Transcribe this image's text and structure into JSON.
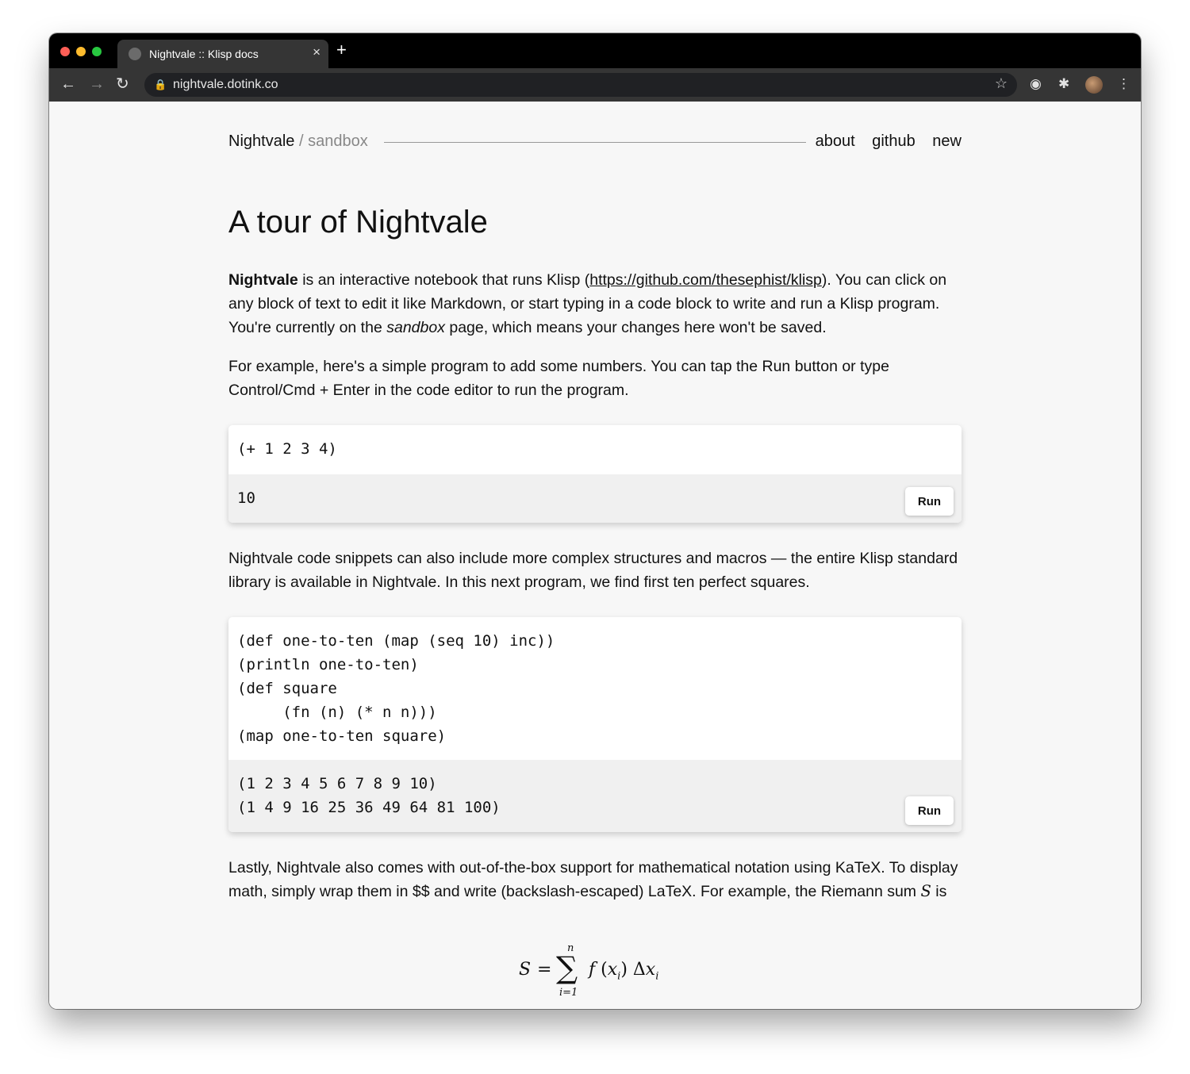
{
  "browser": {
    "tab_title": "Nightvale :: Klisp docs",
    "tab_close": "×",
    "new_tab": "+",
    "url": "nightvale.dotink.co",
    "icons": [
      "back-arrow-icon",
      "forward-arrow-icon",
      "reload-icon",
      "lock-icon",
      "star-icon",
      "pocket-icon",
      "extensions-icon",
      "avatar",
      "menu-icon"
    ]
  },
  "header": {
    "brand": "Nightvale",
    "separator": "/",
    "sub": "sandbox",
    "links": [
      "about",
      "github",
      "new"
    ]
  },
  "main": {
    "title": "A tour of Nightvale",
    "p1": {
      "bold": "Nightvale",
      "text_a": " is an interactive notebook that runs Klisp (",
      "link": "https://github.com/thesephist/klisp",
      "text_b": "). You can click on any block of text to edit it like Markdown, or start typing in a code block to write and run a Klisp program. You're currently on the ",
      "em": "sandbox",
      "text_c": " page, which means your changes here won't be saved."
    },
    "p2": "For example, here's a simple program to add some numbers. You can tap the Run button or type Control/Cmd + Enter in the code editor to run the program.",
    "block1": {
      "code": "(+ 1 2 3 4)",
      "output": "10",
      "run_label": "Run"
    },
    "p3": "Nightvale code snippets can also include more complex structures and macros — the entire Klisp standard library is available in Nightvale. In this next program, we find first ten perfect squares.",
    "block2": {
      "code": "(def one-to-ten (map (seq 10) inc))\n(println one-to-ten)\n(def square\n     (fn (n) (* n n)))\n(map one-to-ten square)",
      "output": "(1 2 3 4 5 6 7 8 9 10)\n(1 4 9 16 25 36 49 64 81 100)",
      "run_label": "Run"
    },
    "p4": {
      "text_a": "Lastly, Nightvale also comes with out-of-the-box support for mathematical notation using KaTeX. To display math, simply wrap them in $$ and write (backslash-escaped) LaTeX. For example, the Riemann sum ",
      "var": "S",
      "text_b": " is"
    },
    "math": {
      "lhs": "S",
      "eq": "=",
      "sigma": "∑",
      "upper": "n",
      "lower": "i=1",
      "f": "f",
      "x": "x",
      "sub_i": "i",
      "delta": "Δ"
    }
  }
}
